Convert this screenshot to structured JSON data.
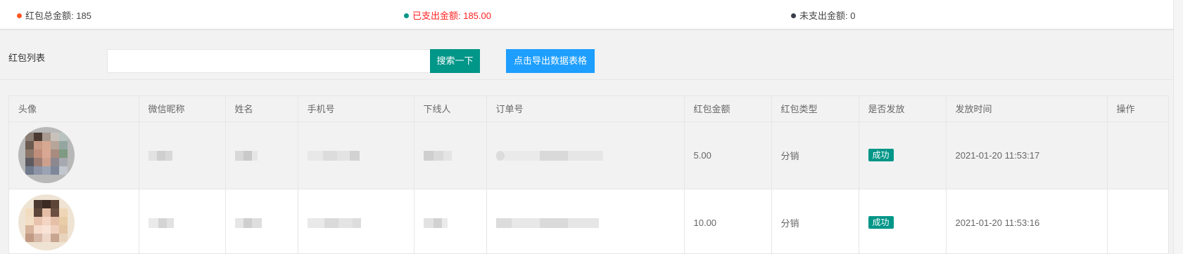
{
  "summary": {
    "total_label": "红包总金额: 185",
    "paid_label": "已支出金额: 185.00",
    "unpaid_label": "未支出金额: 0",
    "colors": {
      "total_dot": "#ff5722",
      "paid_dot": "#009688",
      "unpaid_dot": "#393d49",
      "paid_text": "#ff2222"
    }
  },
  "toolbar": {
    "title": "红包列表",
    "search_placeholder": "",
    "search_value": "",
    "search_button": "搜索一下",
    "export_button": "点击导出数据表格"
  },
  "table": {
    "headers": [
      "头像",
      "微信昵称",
      "姓名",
      "手机号",
      "下线人",
      "订单号",
      "红包金额",
      "红包类型",
      "是否发放",
      "发放时间",
      "操作"
    ],
    "rows": [
      {
        "amount": "5.00",
        "type": "分销",
        "status": "成功",
        "time": "2021-01-20 11:53:17"
      },
      {
        "amount": "10.00",
        "type": "分销",
        "status": "成功",
        "time": "2021-01-20 11:53:16"
      }
    ]
  },
  "icons": [
    "dot-icon"
  ]
}
